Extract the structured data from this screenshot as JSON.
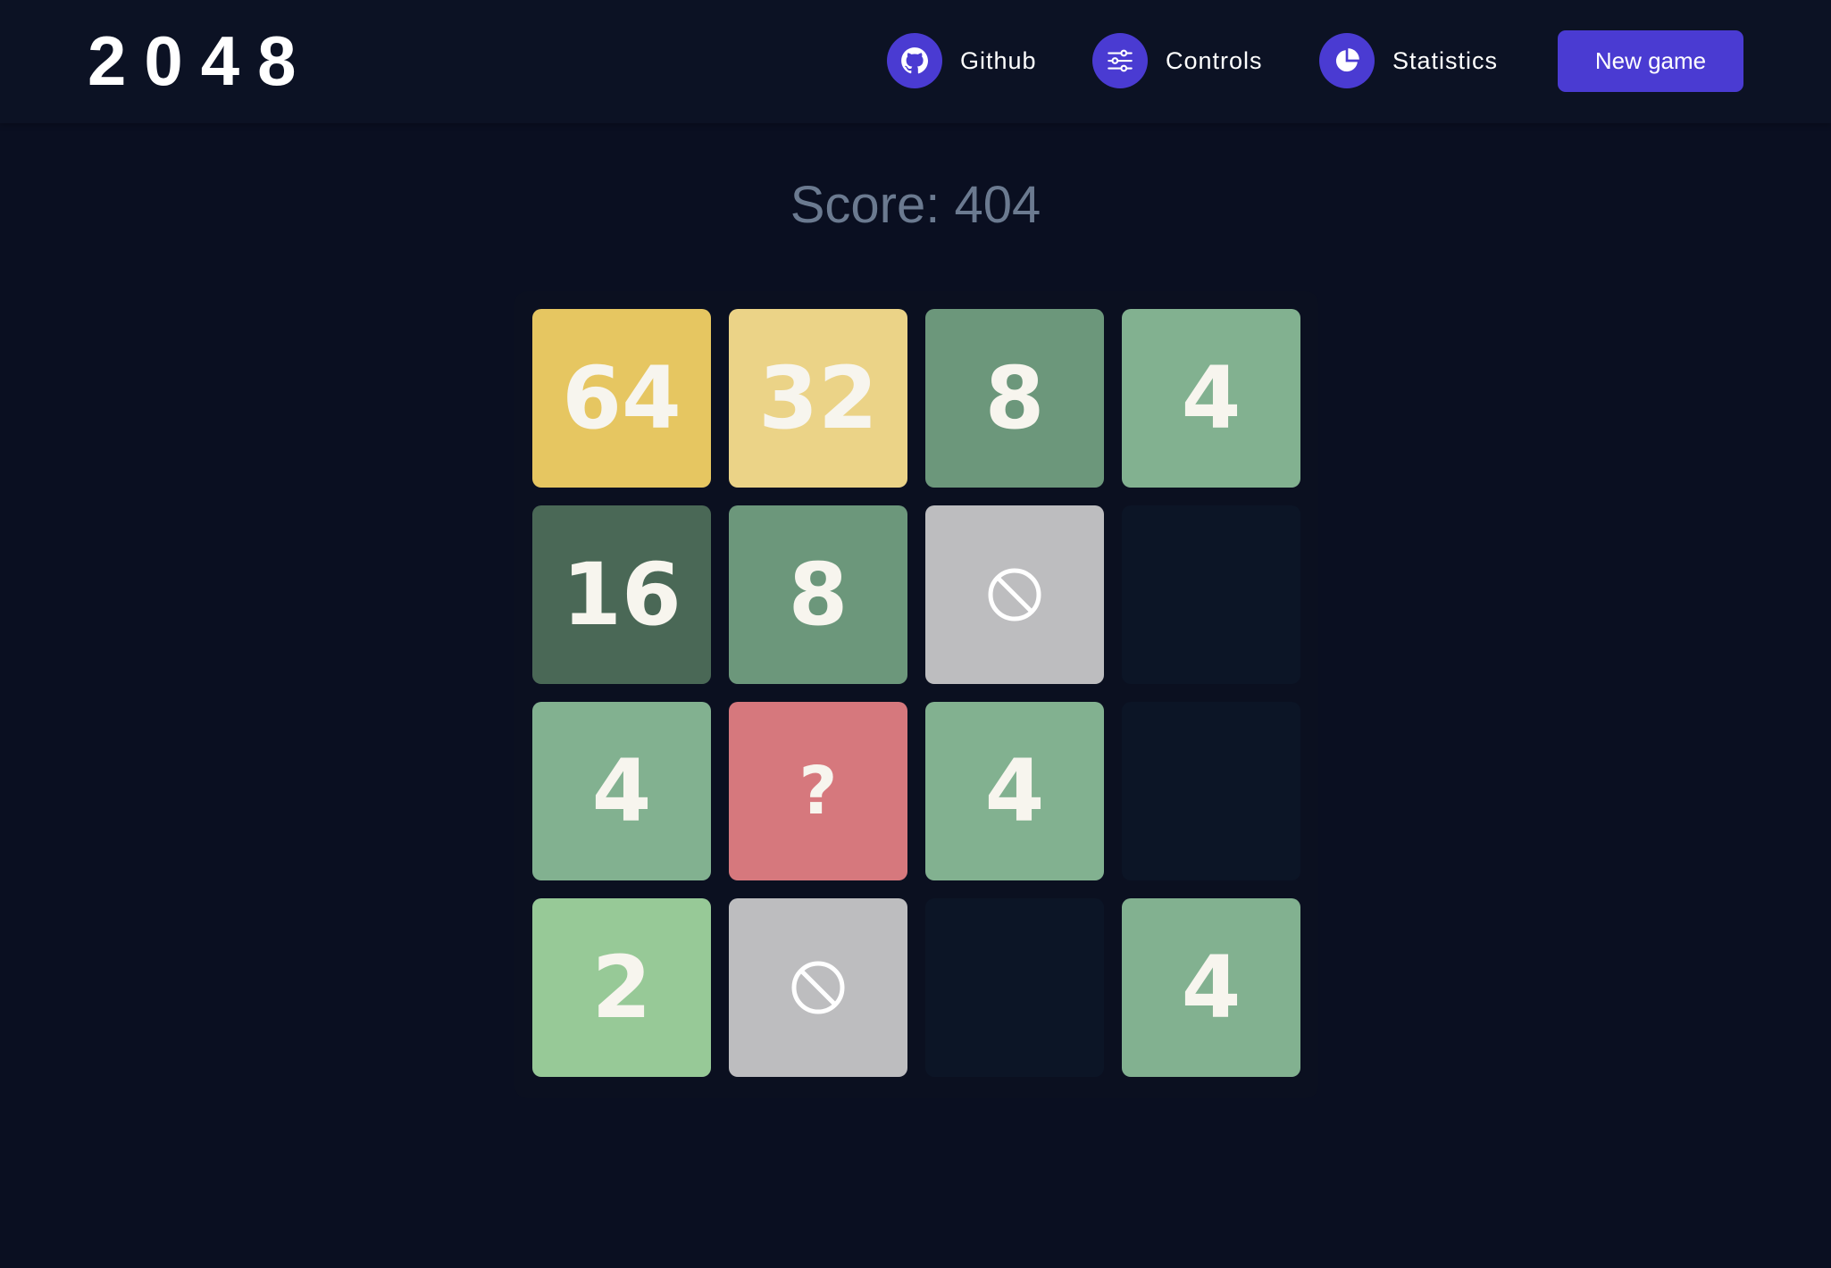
{
  "header": {
    "logo": "2048",
    "nav": [
      {
        "label": "Github",
        "icon": "github-icon"
      },
      {
        "label": "Controls",
        "icon": "sliders-icon"
      },
      {
        "label": "Statistics",
        "icon": "pie-chart-icon"
      }
    ],
    "new_game_label": "New game"
  },
  "score": {
    "text": "Score: 404"
  },
  "colors": {
    "accent": "#4a3bd2",
    "background": "#0a0f21",
    "empty_cell": "#0c1526",
    "blocked": "#bdbdbf",
    "mystery": "#d6787d",
    "t2": "#97c997",
    "t4": "#82b190",
    "t8": "#6c977b",
    "t16": "#4a6856",
    "t32": "#ebd387",
    "t64": "#e6c661"
  },
  "board": {
    "rows": [
      [
        {
          "type": "number",
          "value": "64",
          "color": "#e6c661"
        },
        {
          "type": "number",
          "value": "32",
          "color": "#ebd387"
        },
        {
          "type": "number",
          "value": "8",
          "color": "#6c977b"
        },
        {
          "type": "number",
          "value": "4",
          "color": "#82b190"
        }
      ],
      [
        {
          "type": "number",
          "value": "16",
          "color": "#4a6856"
        },
        {
          "type": "number",
          "value": "8",
          "color": "#6c977b"
        },
        {
          "type": "blocked",
          "value": "",
          "color": "#bdbdbf"
        },
        {
          "type": "empty",
          "value": "",
          "color": "#0c1526"
        }
      ],
      [
        {
          "type": "number",
          "value": "4",
          "color": "#82b190"
        },
        {
          "type": "mystery",
          "value": "?",
          "color": "#d6787d"
        },
        {
          "type": "number",
          "value": "4",
          "color": "#82b190"
        },
        {
          "type": "empty",
          "value": "",
          "color": "#0c1526"
        }
      ],
      [
        {
          "type": "number",
          "value": "2",
          "color": "#97c997"
        },
        {
          "type": "blocked",
          "value": "",
          "color": "#bdbdbf"
        },
        {
          "type": "empty",
          "value": "",
          "color": "#0c1526"
        },
        {
          "type": "number",
          "value": "4",
          "color": "#82b190"
        }
      ]
    ]
  }
}
